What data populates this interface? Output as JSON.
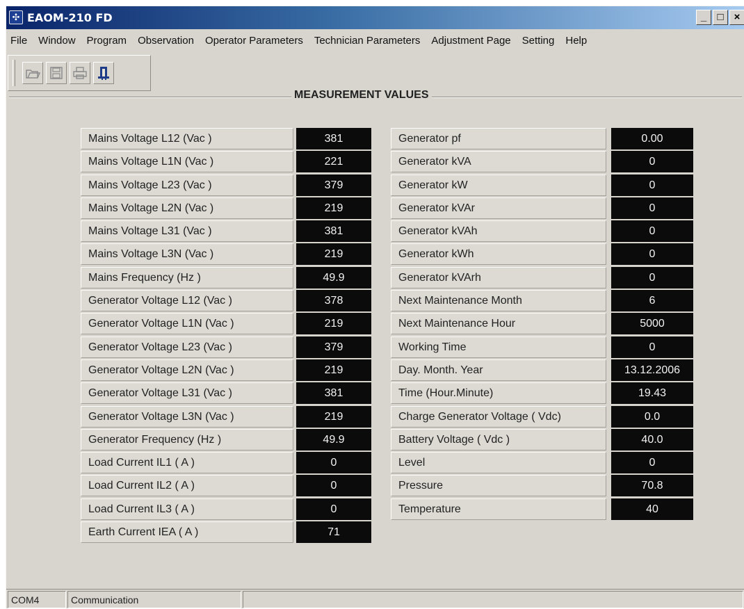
{
  "window": {
    "title": "EAOM-210 FD",
    "min_glyph": "_",
    "max_glyph": "□",
    "close_glyph": "×"
  },
  "menu": [
    "File",
    "Window",
    "Program",
    "Observation",
    "Operator Parameters",
    "Technician Parameters",
    "Adjustment Page",
    "Setting",
    "Help"
  ],
  "toolbar": {
    "buttons": [
      "open-icon",
      "save-icon",
      "print-icon",
      "exit-icon"
    ]
  },
  "section_title": "MEASUREMENT VALUES",
  "left_rows": [
    {
      "label": "Mains Voltage L12  (Vac )",
      "value": "381"
    },
    {
      "label": "Mains Voltage L1N (Vac )",
      "value": "221"
    },
    {
      "label": "Mains Voltage L23 (Vac )",
      "value": "379"
    },
    {
      "label": "Mains Voltage L2N (Vac )",
      "value": "219"
    },
    {
      "label": "Mains Voltage L31 (Vac )",
      "value": "381"
    },
    {
      "label": "Mains Voltage L3N (Vac )",
      "value": "219"
    },
    {
      "label": "Mains Frequency (Hz )",
      "value": "49.9"
    },
    {
      "label": "Generator Voltage L12  (Vac )",
      "value": "378"
    },
    {
      "label": "Generator Voltage L1N (Vac )",
      "value": "219"
    },
    {
      "label": "Generator Voltage L23 (Vac )",
      "value": "379"
    },
    {
      "label": "Generator Voltage L2N (Vac )",
      "value": "219"
    },
    {
      "label": "Generator Voltage L31 (Vac )",
      "value": "381"
    },
    {
      "label": "Generator Voltage L3N (Vac )",
      "value": "219"
    },
    {
      "label": "Generator Frequency (Hz )",
      "value": "49.9"
    },
    {
      "label": "Load Current IL1 ( A )",
      "value": "0"
    },
    {
      "label": "Load Current IL2 ( A )",
      "value": "0"
    },
    {
      "label": "Load Current IL3 ( A )",
      "value": "0"
    },
    {
      "label": "Earth Current IEA ( A )",
      "value": "71"
    }
  ],
  "right_rows": [
    {
      "label": "Generator pf",
      "value": "0.00"
    },
    {
      "label": "Generator kVA",
      "value": "0"
    },
    {
      "label": "Generator kW",
      "value": "0"
    },
    {
      "label": "Generator kVAr",
      "value": "0"
    },
    {
      "label": "Generator kVAh",
      "value": "0"
    },
    {
      "label": "Generator  kWh",
      "value": "0"
    },
    {
      "label": "Generator kVArh",
      "value": "0"
    },
    {
      "label": "Next Maintenance Month",
      "value": "6"
    },
    {
      "label": "Next Maintenance Hour",
      "value": "5000"
    },
    {
      "label": "Working Time",
      "value": "0"
    },
    {
      "label": "Day. Month. Year",
      "value": "13.12.2006"
    },
    {
      "label": "Time (Hour.Minute)",
      "value": "19.43"
    },
    {
      "label": "Charge Generator Voltage ( Vdc)",
      "value": "0.0"
    },
    {
      "label": "Battery Voltage ( Vdc )",
      "value": "40.0"
    },
    {
      "label": "Level",
      "value": "0"
    },
    {
      "label": "Pressure",
      "value": "70.8"
    },
    {
      "label": "Temperature",
      "value": "40"
    }
  ],
  "status": {
    "port": "COM4",
    "state": "Communication",
    "message": ""
  }
}
